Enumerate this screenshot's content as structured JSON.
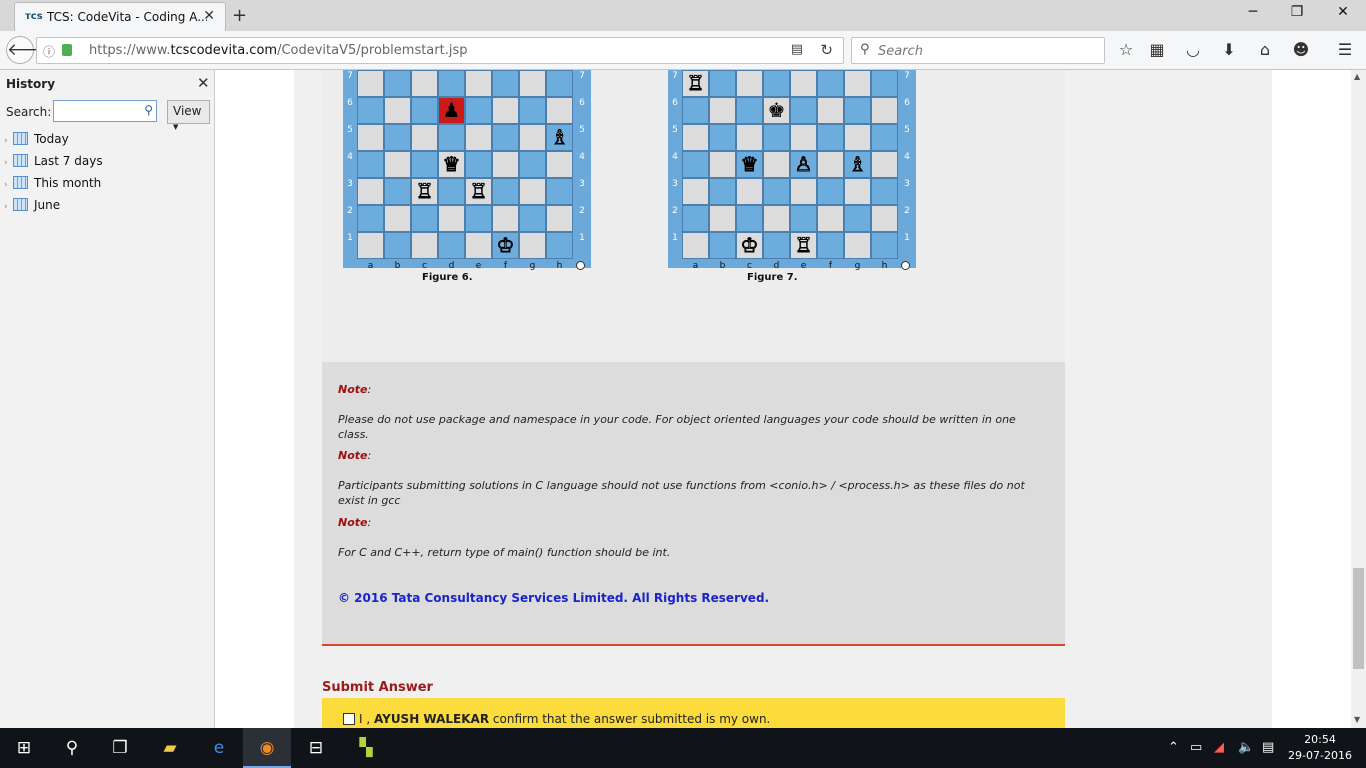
{
  "browser": {
    "tab_title": "TCS: CodeVita - Coding A...",
    "tab_close": "✕",
    "new_tab": "+",
    "url_host_prefix": "https://www.",
    "url_host": "tcscodevita.com",
    "url_path": "/CodevitaV5/problemstart.jsp",
    "search_placeholder": "Search",
    "window_controls": {
      "minimize": "─",
      "restore": "❐",
      "close": "✕"
    }
  },
  "sidebar": {
    "title": "History",
    "close": "✕",
    "search_label": "Search:",
    "view_label": "View",
    "items": [
      {
        "label": "Today"
      },
      {
        "label": "Last 7 days"
      },
      {
        "label": "This month"
      },
      {
        "label": "June"
      }
    ]
  },
  "figures": [
    {
      "caption": "Figure 6.",
      "pieces": [
        {
          "square": "d6",
          "glyph": "♟",
          "color": "black",
          "highlight": true
        },
        {
          "square": "h5",
          "glyph": "♗",
          "color": "white"
        },
        {
          "square": "d4",
          "glyph": "♕",
          "color": "white"
        },
        {
          "square": "c3",
          "glyph": "♖",
          "color": "white"
        },
        {
          "square": "e3",
          "glyph": "♖",
          "color": "white"
        },
        {
          "square": "f1",
          "glyph": "♔",
          "color": "white"
        }
      ]
    },
    {
      "caption": "Figure 7.",
      "pieces": [
        {
          "square": "a7",
          "glyph": "♖",
          "color": "white"
        },
        {
          "square": "d6",
          "glyph": "♚",
          "color": "black"
        },
        {
          "square": "c4",
          "glyph": "♕",
          "color": "white"
        },
        {
          "square": "e4",
          "glyph": "♙",
          "color": "white"
        },
        {
          "square": "g4",
          "glyph": "♗",
          "color": "white"
        },
        {
          "square": "c1",
          "glyph": "♔",
          "color": "white"
        },
        {
          "square": "e1",
          "glyph": "♖",
          "color": "white"
        }
      ]
    }
  ],
  "board_files": [
    "a",
    "b",
    "c",
    "d",
    "e",
    "f",
    "g",
    "h"
  ],
  "board_ranks": [
    "7",
    "6",
    "5",
    "4",
    "3",
    "2",
    "1"
  ],
  "notes": {
    "label": "Note",
    "colon": ":",
    "note1": "Please do not use package and namespace in your code. For object oriented languages your code should be written in one class.",
    "note2": "Participants submitting solutions in C language should not use functions from <conio.h> / <process.h> as these files do not exist in gcc",
    "note3": "For C and C++, return type of main() function should be int.",
    "copyright": "© 2016 Tata Consultancy Services Limited. All Rights Reserved."
  },
  "submit": {
    "heading": "Submit Answer",
    "confirm_prefix": "I , ",
    "confirm_name": "AYUSH WALEKAR",
    "confirm_suffix": " confirm that the answer submitted is my own."
  },
  "taskbar": {
    "time": "20:54",
    "date": "29-07-2016"
  }
}
